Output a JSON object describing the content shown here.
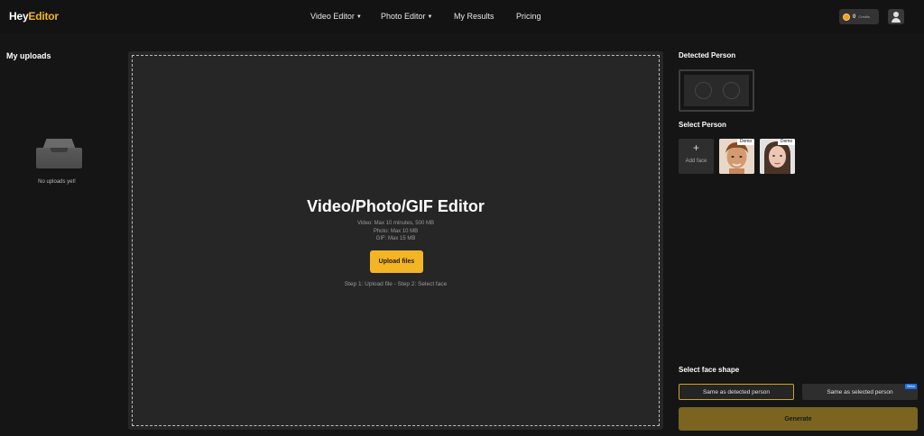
{
  "header": {
    "logo_prefix": "Hey",
    "logo_suffix": "Editor",
    "nav": [
      {
        "label": "Video Editor",
        "has_dropdown": true
      },
      {
        "label": "Photo Editor",
        "has_dropdown": true
      },
      {
        "label": "My Results",
        "has_dropdown": false
      },
      {
        "label": "Pricing",
        "has_dropdown": false
      }
    ],
    "credits_value": "0",
    "credits_label": "Credits"
  },
  "left_panel": {
    "title": "My uploads",
    "empty_text": "No uploads yet!"
  },
  "center": {
    "title": "Video/Photo/GIF Editor",
    "limits": [
      "Video: Max 10 minutes, 500 MB",
      "Photo: Max 10 MB",
      "GIF: Max 15 MB"
    ],
    "upload_button": "Upload files",
    "steps": "Step 1: Upload file - Step 2: Select face"
  },
  "right_panel": {
    "detected_title": "Detected Person",
    "select_title": "Select Person",
    "add_face_label": "Add face",
    "demo_label": "Demo",
    "shape_title": "Select face shape",
    "shape_option_a": "Same as detected person",
    "shape_option_b": "Same as selected person",
    "beta_label": "Beta",
    "generate_label": "Generate"
  },
  "colors": {
    "accent": "#f3b524",
    "background": "#151515",
    "panel": "#262626",
    "generate_disabled": "#7a6420",
    "beta_badge": "#1e6fe0"
  }
}
